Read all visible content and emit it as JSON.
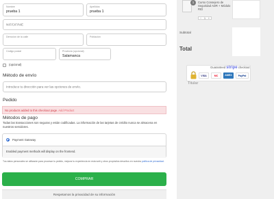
{
  "form": {
    "nombre": {
      "label": "Nombre",
      "value": "prueba 1"
    },
    "apellidos": {
      "label": "Apellidos",
      "value": "prueba 1"
    },
    "nif": {
      "placeholder": "NIF/CIF/NIE"
    },
    "direccion": {
      "label": "Dirección de la calle"
    },
    "poblacion": {
      "label": "Población"
    },
    "codigo_postal": {
      "label": "Código postal"
    },
    "provincia": {
      "label": "Provincia (opcional)",
      "value": "Salamanca"
    },
    "optional_checkbox_label": "(opcional)"
  },
  "shipping": {
    "heading": "Método de envío",
    "placeholder": "Introduce tu dirección para ver las opciones de envío."
  },
  "order": {
    "heading": "Pedido",
    "error_text": "No products added to this checkout page. ",
    "error_link": "Add Product"
  },
  "payment": {
    "heading": "Métodos de pago",
    "secure_text": "Todas las transacciones son seguras y están codificadas. La información de las tarjetas de crédito nunca se almacena en nuestros servidores.",
    "gateway_label": "Payment Gateway",
    "gateway_note": "Enabled payment methods will display on the frontend."
  },
  "privacy_notice": {
    "text": "Tus datos personales se utilizarán para procesar tu pedido, mejorar tu experiencia en esta web y otros propósitos descritos en nuestra ",
    "link": "política de privacidad."
  },
  "buttons": {
    "comprar": "COMPRAR",
    "privacy_bar": "Respetamos la privacidad de su información"
  },
  "summary": {
    "product_name": "Curso Consejero de Seguridad ADR + Módulo RID",
    "qty_badge": "1",
    "stepper_minus": "−",
    "stepper_value": "1",
    "stepper_plus": "+",
    "subtotal_label": "Subtotal",
    "total_label": "Total",
    "trust_prefix": "Guaranteed ",
    "trust_suffix": " checkout",
    "trust_brand": "stripe",
    "cards": [
      "VISA",
      "MC",
      "AMEX",
      "PayPal"
    ],
    "titular": "Titular"
  },
  "colors": {
    "primary_button": "#2bb04a",
    "error_text": "#d33b46",
    "error_bg": "#f9e0e2",
    "stripe": "#6772e5"
  }
}
